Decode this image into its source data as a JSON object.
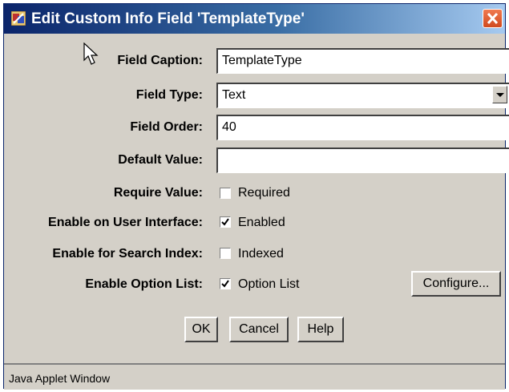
{
  "window": {
    "title": "Edit Custom Info Field 'TemplateType'",
    "status_text": "Java Applet Window"
  },
  "form": {
    "field_caption": {
      "label": "Field Caption:",
      "value": "TemplateType"
    },
    "field_type": {
      "label": "Field Type:",
      "value": "Text"
    },
    "field_order": {
      "label": "Field Order:",
      "value": "40"
    },
    "default_value": {
      "label": "Default Value:",
      "value": ""
    },
    "require_value": {
      "label": "Require Value:",
      "checkbox_label": "Required",
      "checked": false
    },
    "enable_ui": {
      "label": "Enable on User Interface:",
      "checkbox_label": "Enabled",
      "checked": true
    },
    "enable_search": {
      "label": "Enable for Search Index:",
      "checkbox_label": "Indexed",
      "checked": false
    },
    "enable_option_list": {
      "label": "Enable Option List:",
      "checkbox_label": "Option List",
      "checked": true,
      "configure_label": "Configure..."
    }
  },
  "buttons": {
    "ok": "OK",
    "cancel": "Cancel",
    "help": "Help"
  },
  "colors": {
    "titlebar_start": "#0a246a",
    "titlebar_end": "#a6caf0",
    "window_bg": "#d4d0c8",
    "close_button": "#e0582a"
  },
  "icons": {
    "app_icon": "java-applet-icon",
    "close": "close-icon",
    "dropdown": "chevron-down-icon",
    "cursor": "mouse-pointer-icon"
  }
}
